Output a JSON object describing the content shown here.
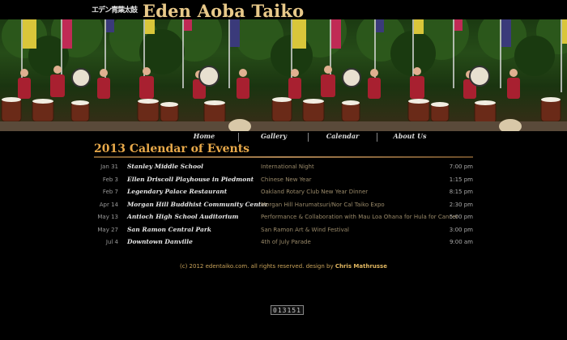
{
  "site": {
    "logo_text": "エデン青葉太鼓",
    "title": "Eden Aoba Taiko"
  },
  "nav": {
    "items": [
      {
        "label": "Home"
      },
      {
        "label": "Gallery"
      },
      {
        "label": "Calendar"
      },
      {
        "label": "About Us"
      }
    ]
  },
  "calendar": {
    "heading": "2013 Calendar of Events",
    "events": [
      {
        "date": "Jan 31",
        "venue": "Stanley Middle School",
        "description": "International Night",
        "time": "7:00 pm"
      },
      {
        "date": "Feb 3",
        "venue": "Ellen Driscoll Playhouse in Piedmont",
        "description": "Chinese New Year",
        "time": "1:15 pm"
      },
      {
        "date": "Feb 7",
        "venue": "Legendary Palace Restaurant",
        "description": "Oakland Rotary Club New Year Dinner",
        "time": "8:15 pm"
      },
      {
        "date": "Apr 14",
        "venue": "Morgan Hill Buddhist Community Center",
        "description": "Morgan Hill Harumatsuri/Nor Cal Taiko Expo",
        "time": "2:30 pm"
      },
      {
        "date": "May 13",
        "venue": "Antioch High School Auditorium",
        "description": "Performance & Collaboration with Mau Loa Ohana for Hula for Cancer",
        "time": "5:00 pm"
      },
      {
        "date": "May 27",
        "venue": "San Ramon Central Park",
        "description": "San Ramon Art & Wind Festival",
        "time": "3:00 pm"
      },
      {
        "date": "Jul 4",
        "venue": "Downtown Danville",
        "description": "4th of July Parade",
        "time": "9:00 am"
      }
    ]
  },
  "footer": {
    "text": "(c) 2012 edentaiko.com.  all rights reserved.  design by ",
    "designer": "Chris Mathrusse"
  },
  "counter": {
    "value": "013151"
  },
  "colors": {
    "title": "#e8c98a",
    "heading": "#e8a94a",
    "footer": "#c9a35a",
    "background": "#000000"
  }
}
